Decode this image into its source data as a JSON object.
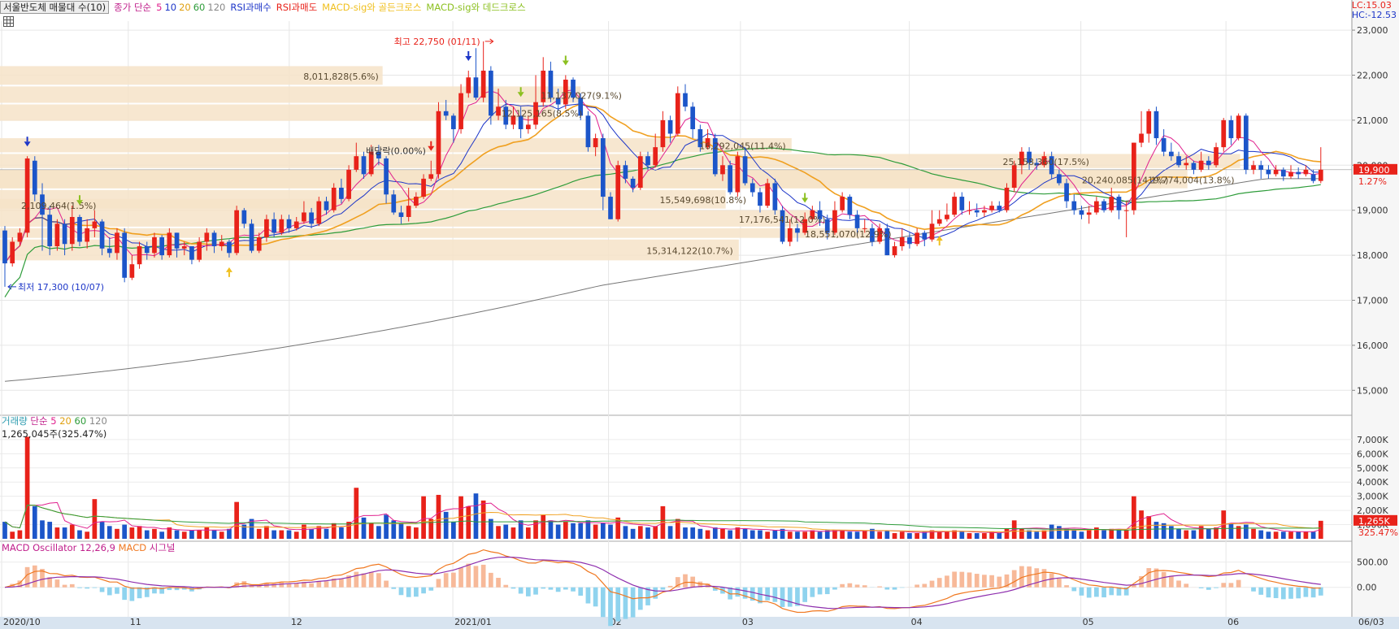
{
  "legend": {
    "title": "서울반도체 매물대 수(10)",
    "price_ma_label": "종가 단순",
    "ma_periods": [
      "5",
      "10",
      "20",
      "60",
      "120"
    ],
    "rsi_buy": "RSI과매수",
    "rsi_sell": "RSI과매도",
    "golden_cross": "MACD-sig와 골든크로스",
    "dead_cross": "MACD-sig와 데드크로스"
  },
  "corner": {
    "lc": "LC:15.03",
    "hc": "HC:-12.53"
  },
  "price_badge": {
    "price": "19,900",
    "change": "1.27%"
  },
  "volume_legend": {
    "label": "거래량",
    "ma_label": "단순",
    "periods": [
      "5",
      "20",
      "60",
      "120"
    ],
    "current": "1,265,045주(325.47%)"
  },
  "volume_badge": {
    "value": "1,265K",
    "pct": "325.47%"
  },
  "macd_legend": {
    "osc": "MACD Oscillator 12,26,9",
    "macd": "MACD",
    "signal": "시그널"
  },
  "colors": {
    "up": "#e8221a",
    "down": "#1c55c9",
    "ma5": "#e0208e",
    "ma10": "#1d36c8",
    "ma20": "#f0a020",
    "ma60": "#2e9c3a",
    "ma120": "#777777",
    "profile": "#f6e3c8",
    "osc_pos": "#f7b999",
    "osc_neg": "#8fd3ee",
    "macd": "#f07820",
    "signal": "#8e2fae"
  },
  "chart_data": {
    "type": "candlestick",
    "price_axis": {
      "range": [
        14500,
        23200
      ],
      "ticks": [
        "23,000",
        "22,000",
        "21,000",
        "20,000",
        "19,000",
        "18,000",
        "17,000",
        "16,000",
        "15,000"
      ]
    },
    "volume_axis": {
      "ticks": [
        "7,000K",
        "6,000K",
        "5,000K",
        "4,000K",
        "3,000K",
        "2,000K",
        "1,000K"
      ]
    },
    "macd_axis": {
      "ticks": [
        "500.00",
        "0.00"
      ]
    },
    "x_labels": [
      "2020/10",
      "11",
      "12",
      "2021/01",
      "02",
      "03",
      "04",
      "05",
      "06",
      "06/03"
    ],
    "annotations": {
      "high": "최고 22,750 (01/11)",
      "low": "최저 17,300 (10/07)",
      "dividend": "배당락(0.00%)"
    },
    "volume_profile": [
      {
        "low": 18950,
        "high": 19250,
        "label": "2,109,464(1.5%)"
      },
      {
        "low": 21750,
        "high": 22200,
        "label": "8,011,828(5.6%)"
      },
      {
        "low": 21350,
        "high": 21750,
        "label": "11,137,027(9.1%)"
      },
      {
        "low": 20950,
        "high": 21350,
        "label": "12,125,165(8.5%)"
      },
      {
        "low": 20250,
        "high": 20600,
        "label": "16,292,045(11.4%)"
      },
      {
        "low": 19900,
        "high": 20250,
        "label": "25,158,360(17.5%)"
      },
      {
        "low": 19450,
        "high": 19900,
        "label": "20,240,085(14.1%)"
      },
      {
        "low": 19450,
        "high": 19900,
        "label": "19,774,004(13.8%)"
      },
      {
        "low": 19000,
        "high": 19450,
        "label": "15,549,698(10.8%)"
      },
      {
        "low": 18600,
        "high": 19000,
        "label": "17,176,541(12.0%)"
      },
      {
        "low": 18350,
        "high": 18600,
        "label": "18,551,070(12.9%)"
      },
      {
        "low": 17850,
        "high": 18350,
        "label": "15,314,122(10.7%)"
      }
    ],
    "candles": [
      [
        18550,
        17820,
        18650,
        17300,
        1.2
      ],
      [
        17820,
        18300,
        18400,
        17750,
        0.5
      ],
      [
        18300,
        18500,
        18600,
        18200,
        0.6
      ],
      [
        18500,
        20150,
        20200,
        18400,
        7.2
      ],
      [
        20100,
        19350,
        20200,
        19200,
        2.3
      ],
      [
        19350,
        18900,
        19600,
        18100,
        1.3
      ],
      [
        18900,
        18200,
        19100,
        18000,
        1.2
      ],
      [
        18200,
        18700,
        18800,
        18100,
        0.8
      ],
      [
        18700,
        18250,
        18800,
        18000,
        0.8
      ],
      [
        18250,
        18850,
        19100,
        18100,
        1.0
      ],
      [
        18850,
        18300,
        18900,
        18200,
        0.6
      ],
      [
        18300,
        18600,
        18800,
        18150,
        0.5
      ],
      [
        18600,
        18750,
        19000,
        18400,
        2.8
      ],
      [
        18750,
        18150,
        18800,
        18000,
        1.2
      ],
      [
        18150,
        18050,
        18400,
        17950,
        0.9
      ],
      [
        18050,
        18500,
        18600,
        17900,
        0.7
      ],
      [
        18500,
        17500,
        18600,
        17400,
        1.0
      ],
      [
        17500,
        17800,
        18000,
        17450,
        0.8
      ],
      [
        17800,
        18200,
        18300,
        17700,
        0.9
      ],
      [
        18200,
        18050,
        18300,
        17900,
        0.6
      ],
      [
        18050,
        18400,
        18500,
        17950,
        0.7
      ],
      [
        18400,
        18000,
        18450,
        17900,
        0.5
      ],
      [
        18000,
        18500,
        18600,
        17950,
        0.8
      ],
      [
        18500,
        18150,
        18500,
        17950,
        0.6
      ],
      [
        18150,
        18200,
        18300,
        18000,
        0.5
      ],
      [
        18200,
        17900,
        18200,
        17800,
        0.6
      ],
      [
        17900,
        18300,
        18400,
        17850,
        0.6
      ],
      [
        18300,
        18500,
        18600,
        18100,
        0.8
      ],
      [
        18500,
        18200,
        18550,
        18050,
        0.6
      ],
      [
        18200,
        18300,
        18450,
        18100,
        0.5
      ],
      [
        18300,
        18050,
        18350,
        17950,
        0.7
      ],
      [
        18050,
        19000,
        19100,
        18000,
        2.6
      ],
      [
        19000,
        18700,
        19050,
        18600,
        1.0
      ],
      [
        18700,
        18100,
        18800,
        18050,
        1.4
      ],
      [
        18100,
        18400,
        18500,
        18050,
        0.7
      ],
      [
        18400,
        18800,
        18900,
        18300,
        0.9
      ],
      [
        18800,
        18500,
        18950,
        18400,
        0.6
      ],
      [
        18500,
        18800,
        18900,
        18450,
        0.6
      ],
      [
        18800,
        18600,
        18900,
        18500,
        0.6
      ],
      [
        18600,
        18750,
        18850,
        18550,
        0.5
      ],
      [
        18750,
        18950,
        19200,
        18700,
        1.0
      ],
      [
        18950,
        18700,
        19050,
        18600,
        0.7
      ],
      [
        18700,
        19200,
        19300,
        18650,
        0.9
      ],
      [
        19200,
        19000,
        19300,
        18900,
        0.7
      ],
      [
        19000,
        19500,
        19600,
        18950,
        1.1
      ],
      [
        19500,
        19250,
        19700,
        19150,
        0.8
      ],
      [
        19250,
        19900,
        20000,
        19200,
        1.2
      ],
      [
        19900,
        20200,
        20500,
        19850,
        3.6
      ],
      [
        20200,
        19800,
        20300,
        19700,
        1.5
      ],
      [
        19800,
        20300,
        20450,
        19750,
        1.1
      ],
      [
        20300,
        20150,
        20450,
        20000,
        0.9
      ],
      [
        20150,
        19350,
        20200,
        19150,
        1.7
      ],
      [
        19350,
        18950,
        19450,
        18900,
        1.3
      ],
      [
        18950,
        18850,
        19100,
        18700,
        1.1
      ],
      [
        18850,
        19100,
        19500,
        18750,
        0.9
      ],
      [
        19100,
        19300,
        19400,
        19050,
        0.8
      ],
      [
        19300,
        19700,
        19800,
        19250,
        3.0
      ],
      [
        19700,
        19800,
        20100,
        19650,
        1.4
      ],
      [
        19800,
        21200,
        21400,
        19700,
        3.1
      ],
      [
        21200,
        21100,
        21450,
        21000,
        1.9
      ],
      [
        21100,
        20800,
        21150,
        20500,
        1.2
      ],
      [
        20800,
        21600,
        21800,
        20700,
        3.0
      ],
      [
        21600,
        21950,
        22100,
        21500,
        2.3
      ],
      [
        21950,
        21500,
        22600,
        21450,
        3.2
      ],
      [
        21500,
        22100,
        22750,
        21400,
        2.7
      ],
      [
        22100,
        21100,
        22200,
        20900,
        1.4
      ],
      [
        21100,
        21300,
        21700,
        21000,
        0.9
      ],
      [
        21300,
        20900,
        21450,
        20800,
        1.0
      ],
      [
        20900,
        21100,
        21300,
        20800,
        0.8
      ],
      [
        21100,
        20800,
        21300,
        20600,
        1.3
      ],
      [
        20800,
        20900,
        21100,
        20700,
        0.8
      ],
      [
        20900,
        21400,
        22000,
        20800,
        1.3
      ],
      [
        21400,
        22100,
        22400,
        21300,
        1.7
      ],
      [
        22100,
        21500,
        22300,
        21400,
        1.3
      ],
      [
        21500,
        21350,
        21700,
        21200,
        1.0
      ],
      [
        21350,
        21900,
        22000,
        21250,
        1.2
      ],
      [
        21900,
        21500,
        21950,
        21400,
        1.1
      ],
      [
        21500,
        21100,
        21600,
        21000,
        1.1
      ],
      [
        21100,
        20400,
        21200,
        20300,
        1.3
      ],
      [
        20400,
        20600,
        20700,
        20200,
        1.0
      ],
      [
        20600,
        19300,
        20700,
        19000,
        1.1
      ],
      [
        19300,
        18800,
        19400,
        18800,
        1.0
      ],
      [
        18800,
        20000,
        20100,
        18750,
        1.5
      ],
      [
        20000,
        19700,
        20100,
        19600,
        0.9
      ],
      [
        19700,
        19500,
        19750,
        19400,
        0.7
      ],
      [
        19500,
        20200,
        20300,
        19450,
        0.9
      ],
      [
        20200,
        20000,
        20300,
        19900,
        0.8
      ],
      [
        20000,
        20400,
        20700,
        19950,
        0.9
      ],
      [
        20400,
        21000,
        21200,
        20300,
        2.3
      ],
      [
        21000,
        20700,
        21100,
        20500,
        0.9
      ],
      [
        20700,
        21600,
        21750,
        20650,
        1.4
      ],
      [
        21600,
        21300,
        21800,
        21200,
        0.8
      ],
      [
        21300,
        20800,
        21400,
        20600,
        0.8
      ],
      [
        20800,
        20400,
        20900,
        20300,
        0.7
      ],
      [
        20400,
        20600,
        20800,
        20350,
        0.6
      ],
      [
        20600,
        19800,
        20700,
        19750,
        0.8
      ],
      [
        19800,
        20000,
        20200,
        19650,
        0.7
      ],
      [
        20000,
        19400,
        20100,
        19350,
        0.6
      ],
      [
        19400,
        20200,
        20300,
        19300,
        0.8
      ],
      [
        20200,
        19600,
        20400,
        19550,
        0.7
      ],
      [
        19600,
        19400,
        19700,
        19300,
        0.6
      ],
      [
        19400,
        19100,
        19500,
        18950,
        0.6
      ],
      [
        19100,
        19600,
        19700,
        19050,
        0.5
      ],
      [
        19600,
        19000,
        19700,
        18900,
        0.6
      ],
      [
        19000,
        18300,
        19100,
        18250,
        0.7
      ],
      [
        18300,
        18600,
        18800,
        18200,
        0.5
      ],
      [
        18600,
        18500,
        18700,
        18300,
        0.5
      ],
      [
        18500,
        18800,
        18950,
        18450,
        0.5
      ],
      [
        18800,
        19000,
        19100,
        18750,
        0.6
      ],
      [
        19000,
        18800,
        19200,
        18650,
        0.5
      ],
      [
        18800,
        18500,
        18900,
        18350,
        0.6
      ],
      [
        18500,
        19000,
        19200,
        18450,
        0.6
      ],
      [
        19000,
        19300,
        19400,
        18950,
        0.6
      ],
      [
        19300,
        18900,
        19350,
        18800,
        0.5
      ],
      [
        18900,
        18600,
        19000,
        18450,
        0.5
      ],
      [
        18600,
        18600,
        18800,
        18500,
        0.6
      ],
      [
        18600,
        18300,
        18700,
        18200,
        0.7
      ],
      [
        18300,
        18600,
        18700,
        18250,
        0.5
      ],
      [
        18600,
        18000,
        18700,
        18000,
        0.6
      ],
      [
        18000,
        18200,
        18300,
        17950,
        0.4
      ],
      [
        18200,
        18400,
        18600,
        18100,
        0.5
      ],
      [
        18400,
        18250,
        18500,
        18150,
        0.4
      ],
      [
        18250,
        18500,
        18600,
        18200,
        0.4
      ],
      [
        18500,
        18350,
        18550,
        18200,
        0.5
      ],
      [
        18350,
        18700,
        19000,
        18300,
        0.6
      ],
      [
        18700,
        18800,
        19000,
        18650,
        0.5
      ],
      [
        18800,
        18900,
        19150,
        18750,
        0.5
      ],
      [
        18900,
        19300,
        19400,
        18850,
        0.6
      ],
      [
        19300,
        19000,
        19400,
        18900,
        0.5
      ],
      [
        19000,
        19000,
        19200,
        18900,
        0.4
      ],
      [
        19000,
        18950,
        19150,
        18850,
        0.4
      ],
      [
        18950,
        19000,
        19100,
        18850,
        0.4
      ],
      [
        19000,
        19100,
        19200,
        18950,
        0.5
      ],
      [
        19100,
        19000,
        19200,
        18950,
        0.4
      ],
      [
        19000,
        19500,
        19600,
        18950,
        0.7
      ],
      [
        19500,
        20000,
        20100,
        19400,
        1.3
      ],
      [
        20000,
        20300,
        20400,
        19800,
        0.7
      ],
      [
        20300,
        20050,
        20400,
        19900,
        0.6
      ],
      [
        20050,
        20000,
        20150,
        19900,
        0.5
      ],
      [
        20000,
        20200,
        20300,
        19950,
        0.6
      ],
      [
        20200,
        19800,
        20300,
        19700,
        1.0
      ],
      [
        19800,
        19600,
        19900,
        19550,
        0.9
      ],
      [
        19600,
        19200,
        19700,
        19050,
        0.7
      ],
      [
        19200,
        19000,
        19350,
        18900,
        0.6
      ],
      [
        19000,
        18900,
        19100,
        18800,
        0.5
      ],
      [
        18900,
        18950,
        19100,
        18700,
        0.7
      ],
      [
        18950,
        19200,
        19300,
        18900,
        0.8
      ],
      [
        19200,
        19000,
        19250,
        18950,
        0.6
      ],
      [
        19000,
        19300,
        19500,
        18950,
        0.7
      ],
      [
        19300,
        19000,
        19350,
        18800,
        0.6
      ],
      [
        19000,
        19000,
        19200,
        18400,
        0.6
      ],
      [
        19000,
        20500,
        20500,
        18900,
        3.0
      ],
      [
        20500,
        20700,
        21200,
        20400,
        2.0
      ],
      [
        20700,
        21200,
        21250,
        20500,
        1.6
      ],
      [
        21200,
        20600,
        21300,
        20450,
        1.2
      ],
      [
        20600,
        20300,
        20800,
        20200,
        1.1
      ],
      [
        20300,
        20200,
        20500,
        20100,
        0.9
      ],
      [
        20200,
        20000,
        20300,
        19950,
        0.7
      ],
      [
        20000,
        20050,
        20200,
        19900,
        0.6
      ],
      [
        20050,
        19900,
        20100,
        19800,
        0.6
      ],
      [
        19900,
        20100,
        20300,
        19850,
        0.9
      ],
      [
        20100,
        20000,
        20200,
        19900,
        0.7
      ],
      [
        20000,
        20400,
        20500,
        19950,
        0.8
      ],
      [
        20400,
        21000,
        21050,
        20300,
        2.0
      ],
      [
        21000,
        20600,
        21100,
        20450,
        1.1
      ],
      [
        20600,
        21100,
        21150,
        20550,
        0.9
      ],
      [
        21100,
        19900,
        21150,
        19800,
        1.0
      ],
      [
        19900,
        20000,
        20100,
        19800,
        0.7
      ],
      [
        20000,
        19900,
        20100,
        19700,
        0.6
      ],
      [
        19900,
        19800,
        20000,
        19700,
        0.5
      ],
      [
        19800,
        19900,
        20000,
        19750,
        0.5
      ],
      [
        19900,
        19750,
        19950,
        19650,
        0.5
      ],
      [
        19750,
        19850,
        20000,
        19700,
        0.5
      ],
      [
        19850,
        19800,
        19950,
        19700,
        0.5
      ],
      [
        19800,
        19900,
        20000,
        19750,
        0.5
      ],
      [
        19800,
        19650,
        19900,
        19600,
        0.5
      ],
      [
        19650,
        19900,
        20400,
        19600,
        1.27
      ]
    ]
  }
}
